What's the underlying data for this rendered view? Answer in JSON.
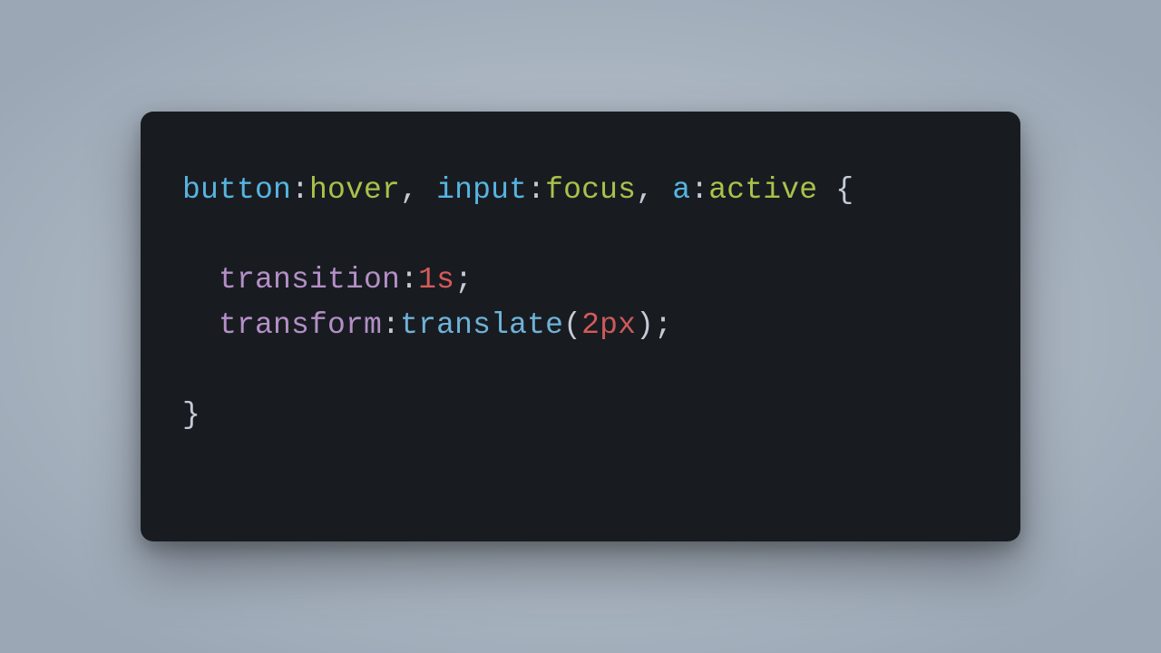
{
  "code": {
    "sel1_tag": "button",
    "colon1": ":",
    "sel1_pseudo": "hover",
    "sep1": ", ",
    "sel2_tag": "input",
    "colon2": ":",
    "sel2_pseudo": "focus",
    "sep2": ", ",
    "sel3_tag": "a",
    "colon3": ":",
    "sel3_pseudo": "active",
    "space_brace": " ",
    "open_brace": "{",
    "indent": "  ",
    "prop1": "transition",
    "prop1_colon": ":",
    "val1_num": "1",
    "val1_unit": "s",
    "semi1": ";",
    "prop2": "transform",
    "prop2_colon": ":",
    "func2": "translate",
    "lparen": "(",
    "arg2_num": "2",
    "arg2_unit": "px",
    "rparen": ")",
    "semi2": ";",
    "close_brace": "}"
  }
}
